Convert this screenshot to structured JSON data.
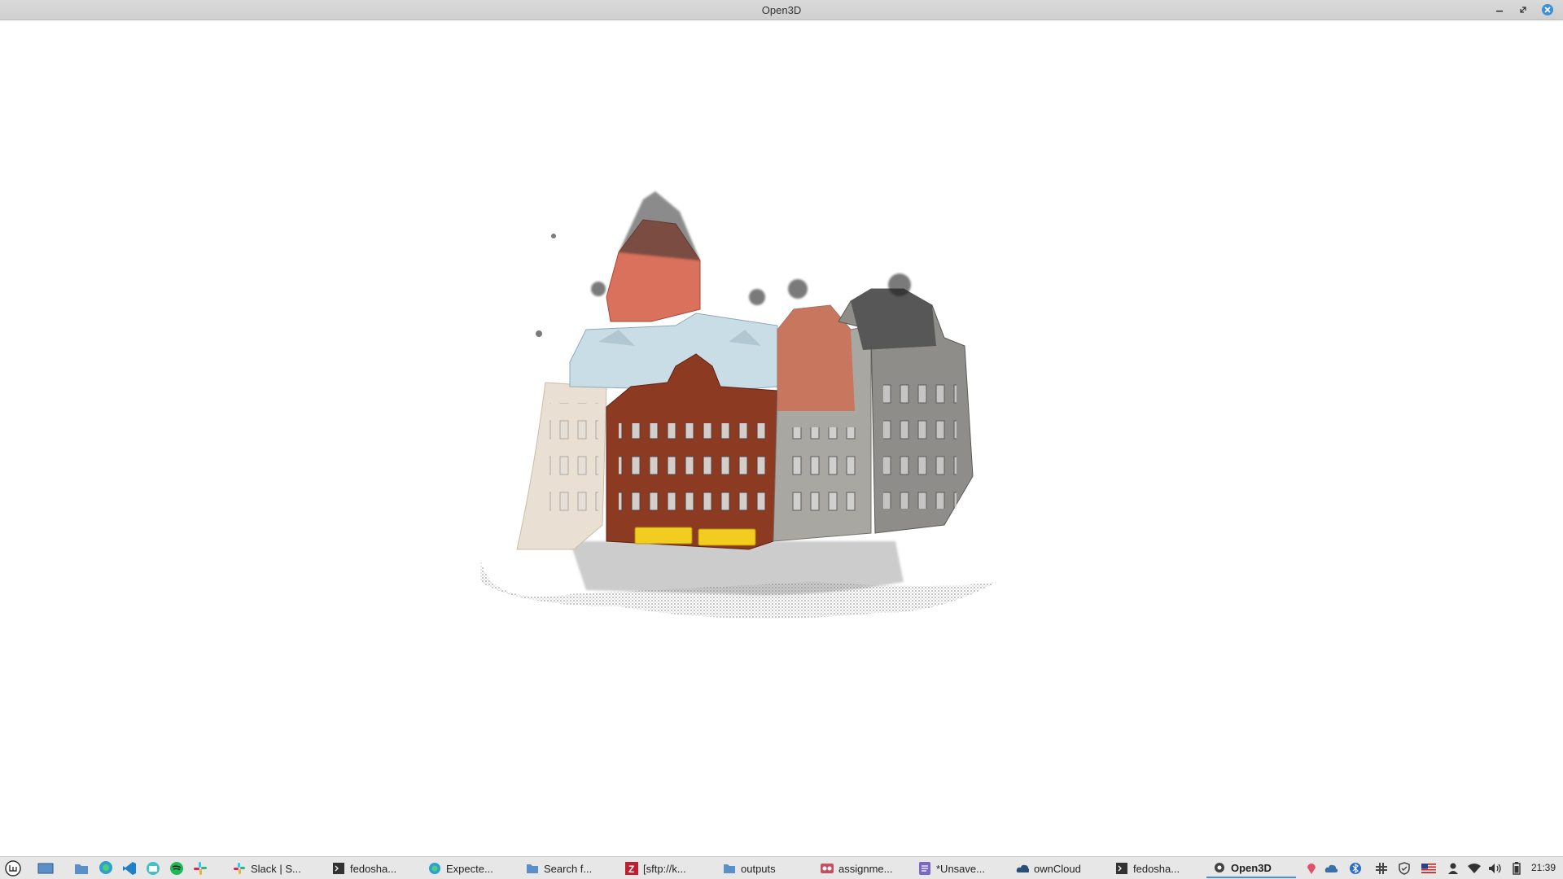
{
  "window": {
    "title": "Open3D"
  },
  "taskbar": {
    "tasks": [
      {
        "label": "Slack | S...",
        "icon": "slack-icon"
      },
      {
        "label": "fedosha...",
        "icon": "terminal-icon"
      },
      {
        "label": "Expecte...",
        "icon": "edge-beta-icon"
      },
      {
        "label": "Search f...",
        "icon": "folder-icon"
      },
      {
        "label": "[sftp://k...",
        "icon": "filezilla-icon"
      },
      {
        "label": "outputs",
        "icon": "folder-icon"
      },
      {
        "label": "assignme...",
        "icon": "document-viewer-icon"
      },
      {
        "label": "*Unsave...",
        "icon": "text-editor-icon"
      },
      {
        "label": "ownCloud",
        "icon": "owncloud-icon"
      },
      {
        "label": "fedosha...",
        "icon": "terminal-icon"
      },
      {
        "label": "Open3D",
        "icon": "open3d-gear-icon",
        "active": true
      }
    ],
    "clock": "21:39"
  },
  "colors": {
    "accent": "#4a90d9",
    "close": "#3d8fd6",
    "roof_light": "#c9dde6",
    "brick": "#8c3b22",
    "orange_tower": "#d9715c",
    "grey_facade": "#a9a7a1",
    "yellow_sign": "#f2cc1f"
  }
}
